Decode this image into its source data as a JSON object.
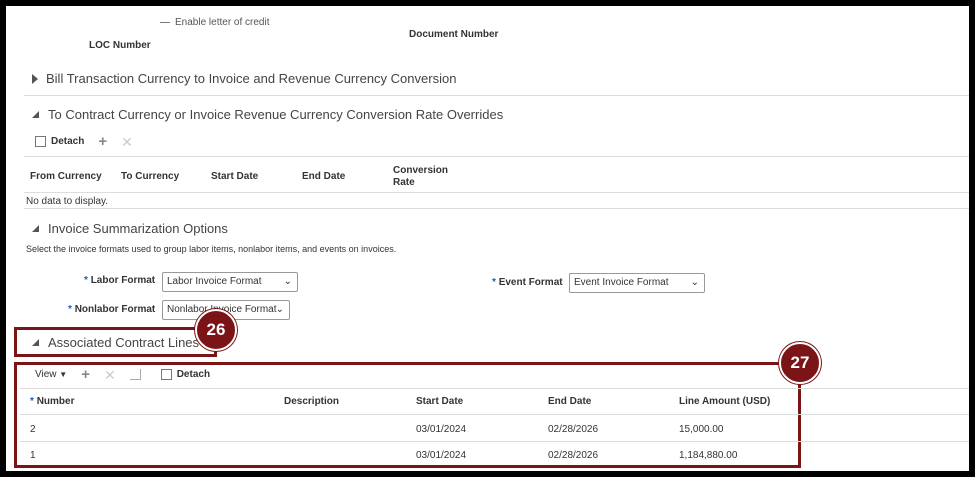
{
  "header": {
    "enable_loc_label": "Enable letter of credit",
    "loc_number_label": "LOC Number",
    "document_number_label": "Document Number"
  },
  "sections": {
    "bill_transaction": "Bill Transaction Currency to Invoice and Revenue Currency Conversion",
    "rate_overrides": "To Contract Currency or Invoice Revenue Currency Conversion Rate Overrides",
    "invoice_summarization": "Invoice Summarization Options",
    "associated_lines": "Associated Contract Lines"
  },
  "rate_table": {
    "detach_label": "Detach",
    "columns": [
      "From Currency",
      "To Currency",
      "Start Date",
      "End Date",
      "Conversion",
      "Rate"
    ],
    "empty_text": "No data to display."
  },
  "invoice_options": {
    "description": "Select the invoice formats used to group labor items, nonlabor items, and events on invoices.",
    "labor_format_label": "Labor Format",
    "labor_format_value": "Labor Invoice Format",
    "nonlabor_format_label": "Nonlabor Format",
    "nonlabor_format_value": "Nonlabor Invoice Format",
    "event_format_label": "Event Format",
    "event_format_value": "Event Invoice Format",
    "required_mark": "*"
  },
  "lines_table": {
    "view_label": "View",
    "detach_label": "Detach",
    "columns": [
      "Number",
      "Description",
      "Start Date",
      "End Date",
      "Line Amount (USD)"
    ],
    "rows": [
      {
        "number": "2",
        "description": "",
        "start": "03/01/2024",
        "end": "02/28/2026",
        "amount": "15,000.00"
      },
      {
        "number": "1",
        "description": "",
        "start": "03/01/2024",
        "end": "02/28/2026",
        "amount": "1,184,880.00"
      }
    ]
  },
  "callouts": {
    "c26": "26",
    "c27": "27"
  },
  "colors": {
    "callout": "#7a1416",
    "required": "#1a5fb4"
  }
}
